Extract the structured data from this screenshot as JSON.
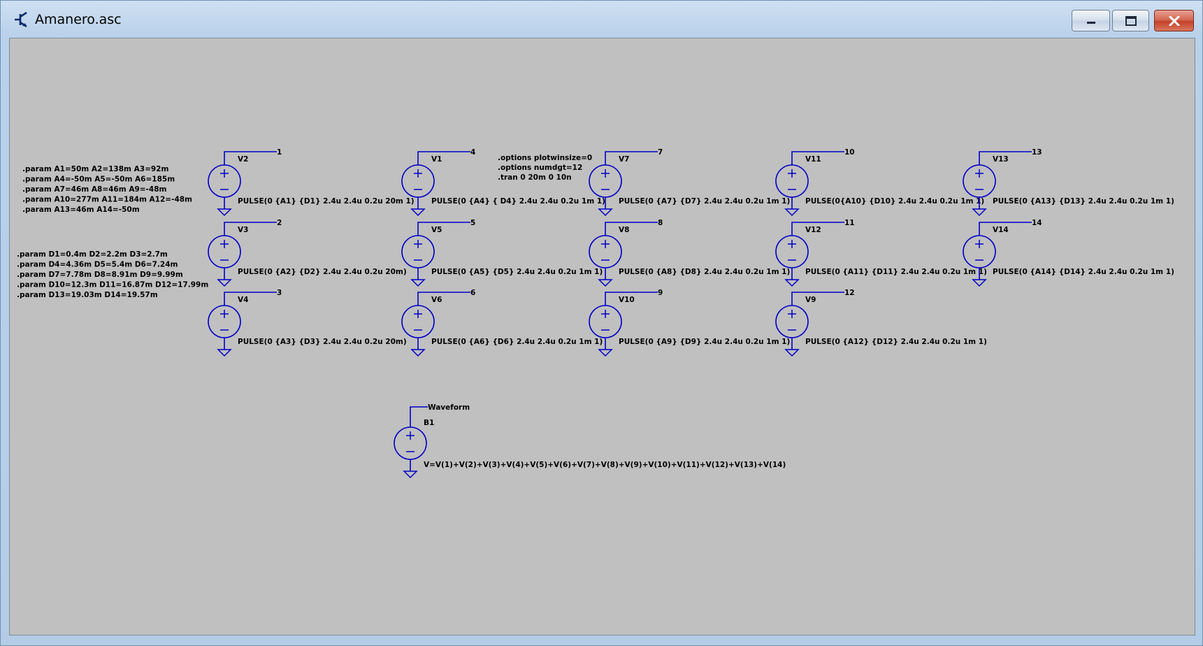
{
  "window": {
    "title": "Amanero.asc",
    "icon": "ltspice-icon",
    "controls": [
      "minimize-icon",
      "maximize-icon",
      "close-icon"
    ]
  },
  "colors": {
    "wire": "#0000c8",
    "canvas": "#c0c0c0",
    "text": "#000000",
    "close_button": "#c74a34"
  },
  "schematic": {
    "param_blocks": [
      [
        ".param A1=50m A2=138m A3=92m",
        ".param A4=-50m A5=-50m A6=185m",
        ".param A7=46m A8=46m A9=-48m",
        ".param A10=277m A11=184m A12=-48m",
        ".param A13=46m A14=-50m"
      ],
      [
        ".param D1=0.4m D2=2.2m D3=2.7m",
        ".param D4=4.36m D5=5.4m D6=7.24m",
        ".param D7=7.78m D8=8.91m D9=9.99m",
        ".param D10=12.3m D11=16.87m D12=17.99m",
        ".param D13=19.03m D14=19.57m"
      ]
    ],
    "directives": [
      ".options plotwinsize=0",
      ".options numdgt=12",
      ".tran 0 20m 0 10n"
    ],
    "sources": [
      {
        "name": "V2",
        "node": "1",
        "value": "PULSE(0 {A1} {D1} 2.4u 2.4u 0.2u 20m 1)"
      },
      {
        "name": "V1",
        "node": "4",
        "value": "PULSE(0 {A4} { D4} 2.4u 2.4u 0.2u 1m 1)"
      },
      {
        "name": "V7",
        "node": "7",
        "value": "PULSE(0 {A7} {D7} 2.4u 2.4u 0.2u 1m 1)"
      },
      {
        "name": "V11",
        "node": "10",
        "value": "PULSE(0{A10} {D10} 2.4u 2.4u 0.2u 1m 1)"
      },
      {
        "name": "V13",
        "node": "13",
        "value": "PULSE(0 {A13} {D13} 2.4u 2.4u 0.2u 1m 1)"
      },
      {
        "name": "V3",
        "node": "2",
        "value": "PULSE(0 {A2} {D2} 2.4u 2.4u 0.2u 20m)"
      },
      {
        "name": "V5",
        "node": "5",
        "value": "PULSE(0 {A5} {D5} 2.4u 2.4u 0.2u 1m 1)"
      },
      {
        "name": "V8",
        "node": "8",
        "value": "PULSE(0 {A8} {D8} 2.4u 2.4u 0.2u 1m 1)"
      },
      {
        "name": "V12",
        "node": "11",
        "value": "PULSE(0 {A11} {D11} 2.4u 2.4u 0.2u 1m 1)"
      },
      {
        "name": "V14",
        "node": "14",
        "value": "PULSE(0 {A14} {D14} 2.4u 2.4u 0.2u 1m 1)"
      },
      {
        "name": "V4",
        "node": "3",
        "value": "PULSE(0 {A3} {D3} 2.4u 2.4u 0.2u 20m)"
      },
      {
        "name": "V6",
        "node": "6",
        "value": "PULSE(0 {A6} {D6} 2.4u 2.4u 0.2u 1m 1)"
      },
      {
        "name": "V10",
        "node": "9",
        "value": "PULSE(0 {A9} {D9} 2.4u 2.4u 0.2u 1m 1)"
      },
      {
        "name": "V9",
        "node": "12",
        "value": "PULSE(0 {A12} {D12} 2.4u 2.4u 0.2u 1m 1)"
      },
      {
        "name": "B1",
        "node": "Waveform",
        "value": "V=V(1)+V(2)+V(3)+V(4)+V(5)+V(6)+V(7)+V(8)+V(9)+V(10)+V(11)+V(12)+V(13)+V(14)"
      }
    ]
  }
}
